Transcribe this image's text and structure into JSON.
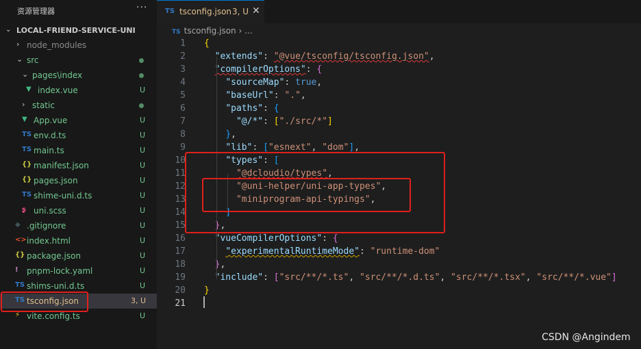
{
  "sidebar": {
    "title": "资源管理器",
    "more": "···",
    "project": "LOCAL-FRIEND-SERVICE-UNI",
    "tree": [
      {
        "name": "node_modules",
        "icon": "chevron-right-icon",
        "glyph": "›",
        "color": "#8c8c8c",
        "badge": "",
        "dot": false
      },
      {
        "name": "src",
        "icon": "chevron-down-icon",
        "glyph": "⌄",
        "color": "#73c991",
        "badge": "",
        "dot": true
      },
      {
        "name": "pages\\index",
        "icon": "chevron-down-icon",
        "glyph": "⌄",
        "color": "#73c991",
        "badge": "",
        "dot": true
      },
      {
        "name": "index.vue",
        "icon": "vue-icon",
        "glyph": "▼",
        "color": "#73c991",
        "badge": "U",
        "dot": false
      },
      {
        "name": "static",
        "icon": "chevron-right-icon",
        "glyph": "›",
        "color": "#73c991",
        "badge": "",
        "dot": true
      },
      {
        "name": "App.vue",
        "icon": "vue-icon",
        "glyph": "▼",
        "color": "#73c991",
        "badge": "U",
        "dot": false
      },
      {
        "name": "env.d.ts",
        "icon": "typescript-icon",
        "glyph": "TS",
        "color": "#73c991",
        "badge": "U",
        "dot": false
      },
      {
        "name": "main.ts",
        "icon": "typescript-icon",
        "glyph": "TS",
        "color": "#73c991",
        "badge": "U",
        "dot": false
      },
      {
        "name": "manifest.json",
        "icon": "json-icon",
        "glyph": "{}",
        "color": "#73c991",
        "badge": "U",
        "dot": false
      },
      {
        "name": "pages.json",
        "icon": "json-icon",
        "glyph": "{}",
        "color": "#73c991",
        "badge": "U",
        "dot": false
      },
      {
        "name": "shime-uni.d.ts",
        "icon": "typescript-icon",
        "glyph": "TS",
        "color": "#73c991",
        "badge": "U",
        "dot": false
      },
      {
        "name": "uni.scss",
        "icon": "sass-icon",
        "glyph": "ʂ",
        "color": "#73c991",
        "badge": "U",
        "dot": false
      },
      {
        "name": ".gitignore",
        "icon": "git-icon",
        "glyph": "◆",
        "color": "#73c991",
        "badge": "U",
        "dot": false
      },
      {
        "name": "index.html",
        "icon": "html-icon",
        "glyph": "<>",
        "color": "#73c991",
        "badge": "U",
        "dot": false
      },
      {
        "name": "package.json",
        "icon": "json-icon",
        "glyph": "{}",
        "color": "#73c991",
        "badge": "U",
        "dot": false
      },
      {
        "name": "pnpm-lock.yaml",
        "icon": "yaml-icon",
        "glyph": "!",
        "color": "#73c991",
        "badge": "U",
        "dot": false
      },
      {
        "name": "shims-uni.d.ts",
        "icon": "typescript-icon",
        "glyph": "TS",
        "color": "#73c991",
        "badge": "U",
        "dot": false
      },
      {
        "name": "tsconfig.json",
        "icon": "tsconfig-icon",
        "glyph": "TS",
        "color": "#e2c08d",
        "badge": "3, U",
        "dot": false
      },
      {
        "name": "vite.config.ts",
        "icon": "vite-icon",
        "glyph": "⚡",
        "color": "#73c991",
        "badge": "U",
        "dot": false
      }
    ]
  },
  "tab": {
    "name": "tsconfig.json",
    "badge": "3, U",
    "close": "✕"
  },
  "breadcrumb": {
    "file": "tsconfig.json",
    "sep": " › ",
    "more": "..."
  },
  "code_lines": [
    "{",
    "  \"extends\": \"@vue/tsconfig/tsconfig.json\",",
    "  \"compilerOptions\": {",
    "    \"sourceMap\": true,",
    "    \"baseUrl\": \".\",",
    "    \"paths\": {",
    "      \"@/*\": [\"./src/*\"]",
    "    },",
    "    \"lib\": [\"esnext\", \"dom\"],",
    "    \"types\": [",
    "      \"@dcloudio/types\",",
    "      \"@uni-helper/uni-app-types\",",
    "      \"miniprogram-api-typings\",",
    "    ]",
    "  },",
    "  \"vueCompilerOptions\": {",
    "    \"experimentalRuntimeMode\": \"runtime-dom\"",
    "  },",
    "  \"include\": [\"src/**/*.ts\", \"src/**/*.d.ts\", \"src/**/*.tsx\", \"src/**/*.vue\"]",
    "}",
    ""
  ],
  "current_line": 21,
  "watermark": "CSDN @Angindem",
  "colors": {
    "key": "#9cdcfe",
    "string": "#ce9178",
    "keyword": "#569cd6",
    "bracket1": "#ffd700",
    "bracket2": "#da70d6",
    "bracket3": "#179fff",
    "highlight": "#e0201c"
  }
}
